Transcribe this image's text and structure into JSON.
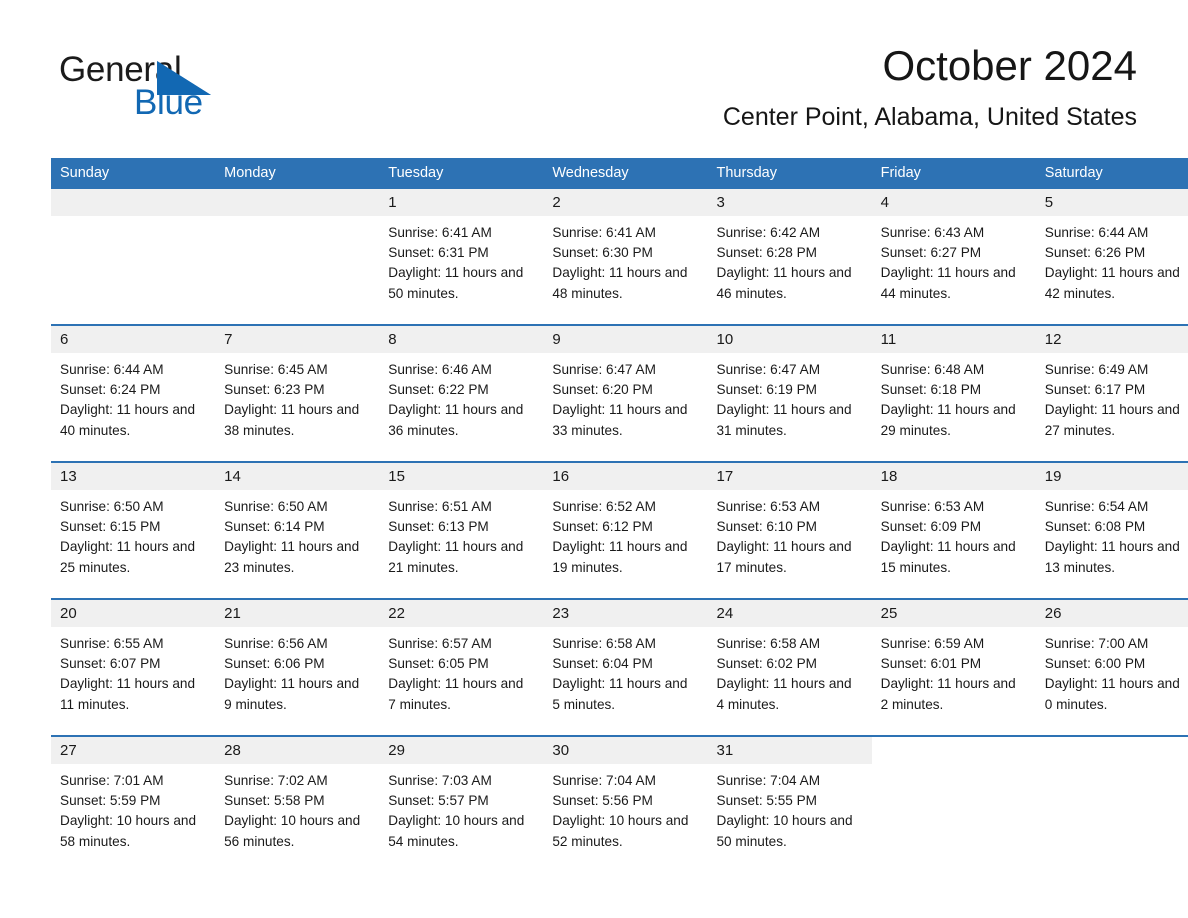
{
  "brand": {
    "name_part1": "General",
    "name_part2": "Blue",
    "accent_color": "#1268b3",
    "triangle_color": "#1268b3"
  },
  "header": {
    "title": "October 2024",
    "subtitle": "Center Point, Alabama, United States"
  },
  "calendar": {
    "header_bg": "#2d72b4",
    "header_text_color": "#ffffff",
    "daynum_band_bg": "#f0f0f0",
    "week_separator_color": "#2d72b4",
    "weekday_headers": [
      "Sunday",
      "Monday",
      "Tuesday",
      "Wednesday",
      "Thursday",
      "Friday",
      "Saturday"
    ],
    "weeks": [
      [
        {
          "day": "",
          "blank": true
        },
        {
          "day": "",
          "blank": true
        },
        {
          "day": "1",
          "sunrise": "Sunrise: 6:41 AM",
          "sunset": "Sunset: 6:31 PM",
          "daylight": "Daylight: 11 hours and 50 minutes."
        },
        {
          "day": "2",
          "sunrise": "Sunrise: 6:41 AM",
          "sunset": "Sunset: 6:30 PM",
          "daylight": "Daylight: 11 hours and 48 minutes."
        },
        {
          "day": "3",
          "sunrise": "Sunrise: 6:42 AM",
          "sunset": "Sunset: 6:28 PM",
          "daylight": "Daylight: 11 hours and 46 minutes."
        },
        {
          "day": "4",
          "sunrise": "Sunrise: 6:43 AM",
          "sunset": "Sunset: 6:27 PM",
          "daylight": "Daylight: 11 hours and 44 minutes."
        },
        {
          "day": "5",
          "sunrise": "Sunrise: 6:44 AM",
          "sunset": "Sunset: 6:26 PM",
          "daylight": "Daylight: 11 hours and 42 minutes."
        }
      ],
      [
        {
          "day": "6",
          "sunrise": "Sunrise: 6:44 AM",
          "sunset": "Sunset: 6:24 PM",
          "daylight": "Daylight: 11 hours and 40 minutes."
        },
        {
          "day": "7",
          "sunrise": "Sunrise: 6:45 AM",
          "sunset": "Sunset: 6:23 PM",
          "daylight": "Daylight: 11 hours and 38 minutes."
        },
        {
          "day": "8",
          "sunrise": "Sunrise: 6:46 AM",
          "sunset": "Sunset: 6:22 PM",
          "daylight": "Daylight: 11 hours and 36 minutes."
        },
        {
          "day": "9",
          "sunrise": "Sunrise: 6:47 AM",
          "sunset": "Sunset: 6:20 PM",
          "daylight": "Daylight: 11 hours and 33 minutes."
        },
        {
          "day": "10",
          "sunrise": "Sunrise: 6:47 AM",
          "sunset": "Sunset: 6:19 PM",
          "daylight": "Daylight: 11 hours and 31 minutes."
        },
        {
          "day": "11",
          "sunrise": "Sunrise: 6:48 AM",
          "sunset": "Sunset: 6:18 PM",
          "daylight": "Daylight: 11 hours and 29 minutes."
        },
        {
          "day": "12",
          "sunrise": "Sunrise: 6:49 AM",
          "sunset": "Sunset: 6:17 PM",
          "daylight": "Daylight: 11 hours and 27 minutes."
        }
      ],
      [
        {
          "day": "13",
          "sunrise": "Sunrise: 6:50 AM",
          "sunset": "Sunset: 6:15 PM",
          "daylight": "Daylight: 11 hours and 25 minutes."
        },
        {
          "day": "14",
          "sunrise": "Sunrise: 6:50 AM",
          "sunset": "Sunset: 6:14 PM",
          "daylight": "Daylight: 11 hours and 23 minutes."
        },
        {
          "day": "15",
          "sunrise": "Sunrise: 6:51 AM",
          "sunset": "Sunset: 6:13 PM",
          "daylight": "Daylight: 11 hours and 21 minutes."
        },
        {
          "day": "16",
          "sunrise": "Sunrise: 6:52 AM",
          "sunset": "Sunset: 6:12 PM",
          "daylight": "Daylight: 11 hours and 19 minutes."
        },
        {
          "day": "17",
          "sunrise": "Sunrise: 6:53 AM",
          "sunset": "Sunset: 6:10 PM",
          "daylight": "Daylight: 11 hours and 17 minutes."
        },
        {
          "day": "18",
          "sunrise": "Sunrise: 6:53 AM",
          "sunset": "Sunset: 6:09 PM",
          "daylight": "Daylight: 11 hours and 15 minutes."
        },
        {
          "day": "19",
          "sunrise": "Sunrise: 6:54 AM",
          "sunset": "Sunset: 6:08 PM",
          "daylight": "Daylight: 11 hours and 13 minutes."
        }
      ],
      [
        {
          "day": "20",
          "sunrise": "Sunrise: 6:55 AM",
          "sunset": "Sunset: 6:07 PM",
          "daylight": "Daylight: 11 hours and 11 minutes."
        },
        {
          "day": "21",
          "sunrise": "Sunrise: 6:56 AM",
          "sunset": "Sunset: 6:06 PM",
          "daylight": "Daylight: 11 hours and 9 minutes."
        },
        {
          "day": "22",
          "sunrise": "Sunrise: 6:57 AM",
          "sunset": "Sunset: 6:05 PM",
          "daylight": "Daylight: 11 hours and 7 minutes."
        },
        {
          "day": "23",
          "sunrise": "Sunrise: 6:58 AM",
          "sunset": "Sunset: 6:04 PM",
          "daylight": "Daylight: 11 hours and 5 minutes."
        },
        {
          "day": "24",
          "sunrise": "Sunrise: 6:58 AM",
          "sunset": "Sunset: 6:02 PM",
          "daylight": "Daylight: 11 hours and 4 minutes."
        },
        {
          "day": "25",
          "sunrise": "Sunrise: 6:59 AM",
          "sunset": "Sunset: 6:01 PM",
          "daylight": "Daylight: 11 hours and 2 minutes."
        },
        {
          "day": "26",
          "sunrise": "Sunrise: 7:00 AM",
          "sunset": "Sunset: 6:00 PM",
          "daylight": "Daylight: 11 hours and 0 minutes."
        }
      ],
      [
        {
          "day": "27",
          "sunrise": "Sunrise: 7:01 AM",
          "sunset": "Sunset: 5:59 PM",
          "daylight": "Daylight: 10 hours and 58 minutes."
        },
        {
          "day": "28",
          "sunrise": "Sunrise: 7:02 AM",
          "sunset": "Sunset: 5:58 PM",
          "daylight": "Daylight: 10 hours and 56 minutes."
        },
        {
          "day": "29",
          "sunrise": "Sunrise: 7:03 AM",
          "sunset": "Sunset: 5:57 PM",
          "daylight": "Daylight: 10 hours and 54 minutes."
        },
        {
          "day": "30",
          "sunrise": "Sunrise: 7:04 AM",
          "sunset": "Sunset: 5:56 PM",
          "daylight": "Daylight: 10 hours and 52 minutes."
        },
        {
          "day": "31",
          "sunrise": "Sunrise: 7:04 AM",
          "sunset": "Sunset: 5:55 PM",
          "daylight": "Daylight: 10 hours and 50 minutes."
        },
        {
          "day": "",
          "blank": true,
          "no_band": true
        },
        {
          "day": "",
          "blank": true,
          "no_band": true
        }
      ]
    ]
  }
}
